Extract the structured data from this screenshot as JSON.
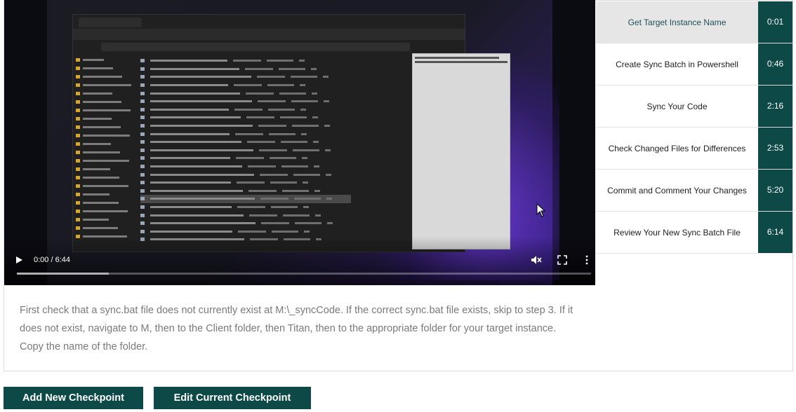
{
  "video": {
    "time_display": "0:00 / 6:44",
    "progress_fraction": 0.0,
    "buffered_fraction": 0.16,
    "controls": {
      "play_icon": "play-icon",
      "mute_icon": "volume-muted-icon",
      "fullscreen_icon": "fullscreen-icon",
      "more_icon": "more-options-icon"
    }
  },
  "checkpoints": [
    {
      "label": "Get Target Instance Name",
      "time": "0:01",
      "active": true
    },
    {
      "label": "Create Sync Batch in Powershell",
      "time": "0:46",
      "active": false
    },
    {
      "label": "Sync Your Code",
      "time": "2:16",
      "active": false
    },
    {
      "label": "Check Changed Files for Differences",
      "time": "2:53",
      "active": false
    },
    {
      "label": "Commit and Comment Your Changes",
      "time": "5:20",
      "active": false
    },
    {
      "label": "Review Your New Sync Batch File",
      "time": "6:14",
      "active": false
    }
  ],
  "description": "First check that a sync.bat file does not currently exist at M:\\_syncCode. If the correct sync.bat file exists, skip to step 3. If it does not exist, navigate to M, then to the Client folder, then Titan, then to the appropriate folder for your target instance. Copy the name of the folder.",
  "buttons": {
    "add_checkpoint": "Add New Checkpoint",
    "edit_checkpoint": "Edit Current Checkpoint"
  },
  "colors": {
    "accent": "#0d4a47",
    "active_row_bg": "#e6e6e6",
    "description_text": "#7a7a7a"
  }
}
